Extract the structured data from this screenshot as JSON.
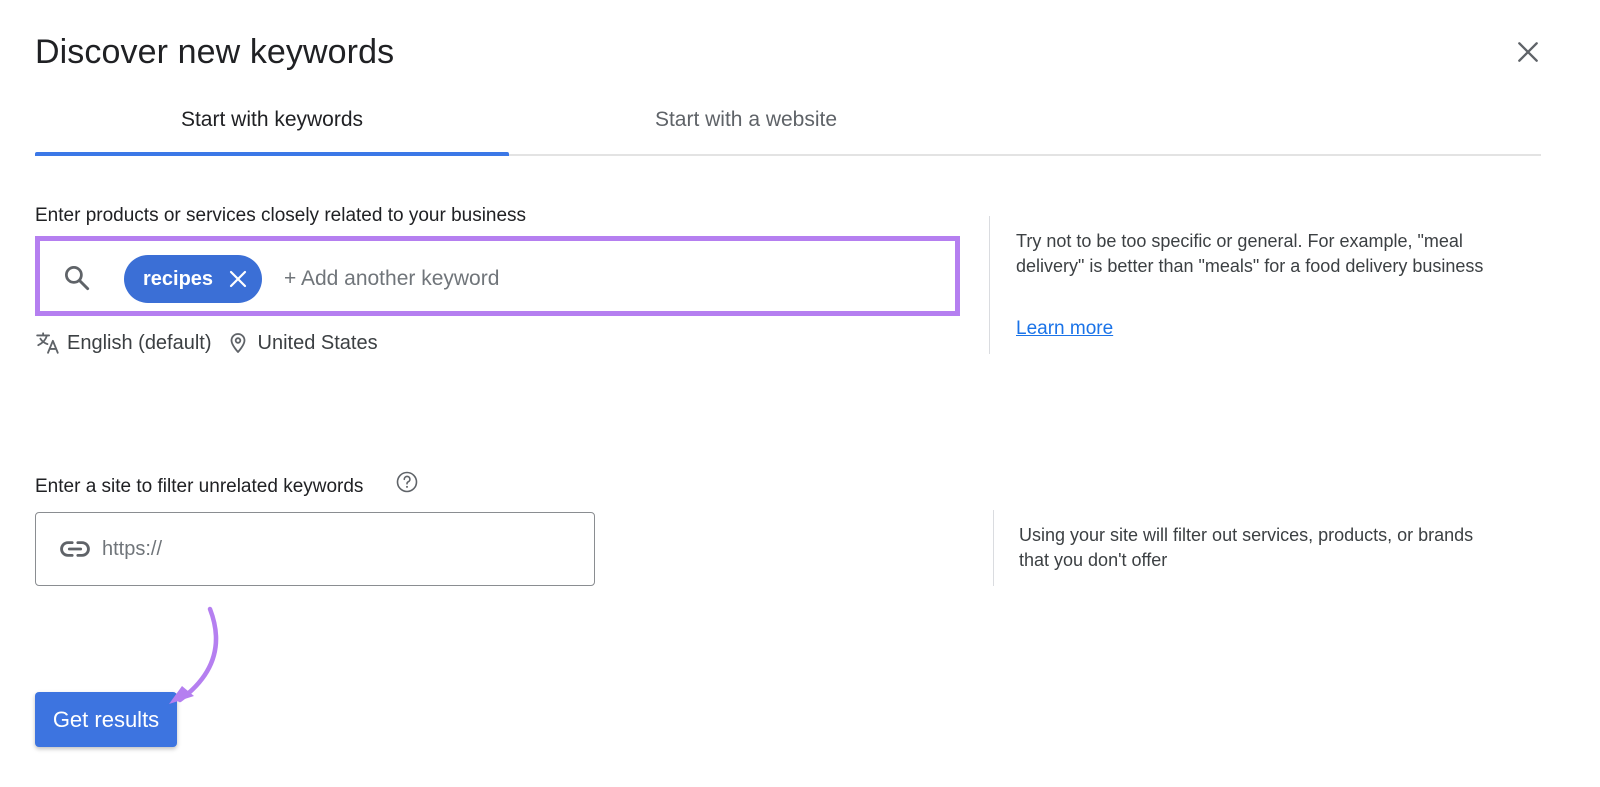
{
  "dialog": {
    "title": "Discover new keywords"
  },
  "tabs": [
    {
      "label": "Start with keywords",
      "active": true
    },
    {
      "label": "Start with a website",
      "active": false
    }
  ],
  "keywords_section": {
    "label": "Enter products or services closely related to your business",
    "chips": [
      {
        "label": "recipes"
      }
    ],
    "input_placeholder": "+ Add another keyword",
    "language": "English (default)",
    "location": "United States",
    "help_text": "Try not to be too specific or general. For example, \"meal delivery\" is better than \"meals\" for a food delivery business",
    "learn_more": "Learn more"
  },
  "site_section": {
    "label": "Enter a site to filter unrelated keywords",
    "input_placeholder": "https://",
    "help_text": "Using your site will filter out services, products, or brands that you don't offer"
  },
  "actions": {
    "get_results": "Get results"
  },
  "colors": {
    "accent": "#3b78e7",
    "chip": "#3b6fd6",
    "highlight_outline": "#b57ff0",
    "link": "#1a73e8"
  },
  "icons": {
    "close": "close-icon",
    "search": "search-icon",
    "chip_remove": "close-icon",
    "language": "translate-icon",
    "location": "location-pin-icon",
    "help": "help-circle-icon",
    "link": "link-icon",
    "annotation": "curved-arrow-annotation"
  }
}
